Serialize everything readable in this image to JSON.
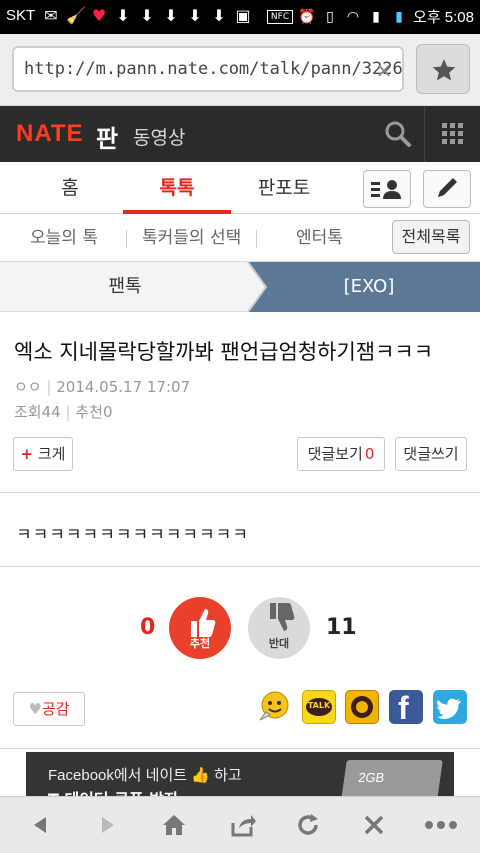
{
  "status_bar": {
    "carrier": "SKT",
    "nfc": "NFC",
    "time": "오후 5:08"
  },
  "browser": {
    "url": "http://m.pann.nate.com/talk/pann/3226"
  },
  "site": {
    "logo": "NATE",
    "section": "판",
    "sub_section": "동영상"
  },
  "tabs": [
    {
      "label": "홈",
      "active": false
    },
    {
      "label": "톡톡",
      "active": true
    },
    {
      "label": "판포토",
      "active": false
    }
  ],
  "subnav": {
    "items": [
      "오늘의 톡",
      "톡커들의 선택",
      "엔터톡"
    ],
    "all_list": "전체목록"
  },
  "breadcrumb": {
    "left": "팬톡",
    "right": "[EXO]"
  },
  "article": {
    "title": "엑소 지네몰락당할까봐 팬언급엄청하기잼ㅋㅋㅋ",
    "author": "ㅇㅇ",
    "date": "2014.05.17 17:07",
    "views_label": "조회",
    "views": "44",
    "recommend_label": "추천",
    "recommend": "0",
    "enlarge_label": "크게",
    "view_comments_label": "댓글보기",
    "comment_count": "0",
    "write_comment_label": "댓글쓰기",
    "body": "ㅋㅋㅋㅋㅋㅋㅋㅋㅋㅋㅋㅋㅋㅋ"
  },
  "vote": {
    "up_count": "0",
    "up_label": "추천",
    "down_label": "반대",
    "down_count": "11"
  },
  "share": {
    "empathy_label": "공감",
    "kakao_label": "TALK"
  },
  "banner": {
    "line1": "Facebook에서 네이트",
    "line1b": "하고",
    "line2": "T 데이터 쿠폰 받자",
    "badge": "2GB"
  },
  "colors": {
    "brand_red": "#e5281f",
    "header_dark": "#2b2b2b",
    "crumb_blue": "#5d7896"
  }
}
